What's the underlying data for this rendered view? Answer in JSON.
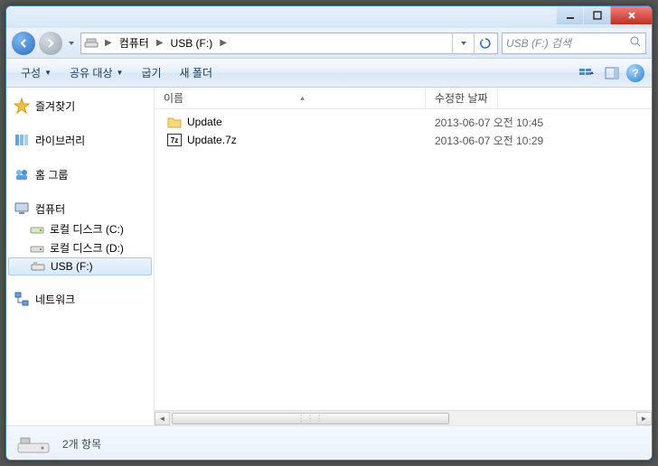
{
  "titlebar": {},
  "nav": {
    "breadcrumb": [
      {
        "label": "컴퓨터"
      },
      {
        "label": "USB (F:)"
      }
    ],
    "search_placeholder": "USB (F:) 검색"
  },
  "toolbar": {
    "organize": "구성",
    "share": "공유 대상",
    "burn": "굽기",
    "newfolder": "새 폴더"
  },
  "sidebar": {
    "favorites": "즐겨찾기",
    "libraries": "라이브러리",
    "homegroup": "홈 그룹",
    "computer": "컴퓨터",
    "computer_items": [
      {
        "label": "로컬 디스크 (C:)"
      },
      {
        "label": "로컬 디스크 (D:)"
      },
      {
        "label": "USB (F:)"
      }
    ],
    "network": "네트워크"
  },
  "columns": {
    "name": "이름",
    "modified": "수정한 날짜"
  },
  "files": [
    {
      "name": "Update",
      "type": "folder",
      "modified": "2013-06-07 오전 10:45"
    },
    {
      "name": "Update.7z",
      "type": "archive",
      "modified": "2013-06-07 오전 10:29"
    }
  ],
  "status": {
    "summary": "2개 항목"
  }
}
